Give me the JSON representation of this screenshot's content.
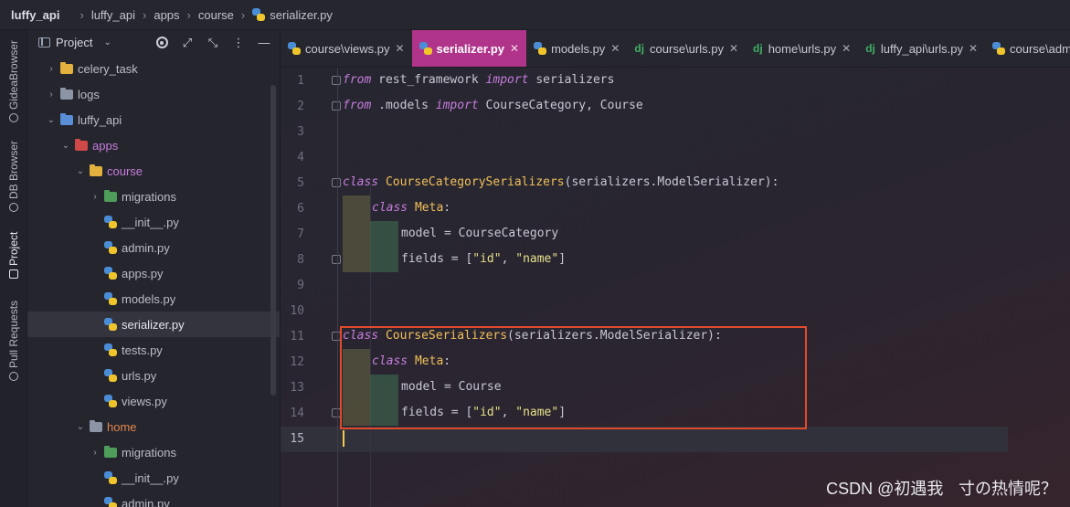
{
  "breadcrumb": {
    "items": [
      "luffy_api",
      "luffy_api",
      "apps",
      "course",
      "serializer.py"
    ]
  },
  "toolstrip": {
    "tabs": [
      "GideaBrowser",
      "DB Browser",
      "Project",
      "Pull Requests"
    ]
  },
  "project_panel": {
    "title": "Project",
    "tree": [
      {
        "label": "celery_task",
        "depth": 1,
        "kind": "folder"
      },
      {
        "label": "logs",
        "depth": 1,
        "kind": "folder"
      },
      {
        "label": "luffy_api",
        "depth": 1,
        "kind": "folder"
      },
      {
        "label": "apps",
        "depth": 2,
        "kind": "folder"
      },
      {
        "label": "course",
        "depth": 3,
        "kind": "folder"
      },
      {
        "label": "migrations",
        "depth": 4,
        "kind": "folder"
      },
      {
        "label": "__init__.py",
        "depth": 4,
        "kind": "file"
      },
      {
        "label": "admin.py",
        "depth": 4,
        "kind": "file"
      },
      {
        "label": "apps.py",
        "depth": 4,
        "kind": "file"
      },
      {
        "label": "models.py",
        "depth": 4,
        "kind": "file"
      },
      {
        "label": "serializer.py",
        "depth": 4,
        "kind": "file"
      },
      {
        "label": "tests.py",
        "depth": 4,
        "kind": "file"
      },
      {
        "label": "urls.py",
        "depth": 4,
        "kind": "file"
      },
      {
        "label": "views.py",
        "depth": 4,
        "kind": "file"
      },
      {
        "label": "home",
        "depth": 3,
        "kind": "folder"
      },
      {
        "label": "migrations",
        "depth": 4,
        "kind": "folder"
      },
      {
        "label": "__init__.py",
        "depth": 4,
        "kind": "file"
      },
      {
        "label": "admin.py",
        "depth": 4,
        "kind": "file"
      }
    ]
  },
  "tabs": [
    {
      "label": "course\\views.py",
      "icon": "python-icon"
    },
    {
      "label": "serializer.py",
      "icon": "python-icon"
    },
    {
      "label": "models.py",
      "icon": "python-icon"
    },
    {
      "label": "course\\urls.py",
      "icon": "django-icon",
      "prefix": "dj"
    },
    {
      "label": "home\\urls.py",
      "icon": "django-icon",
      "prefix": "dj"
    },
    {
      "label": "luffy_api\\urls.py",
      "icon": "django-icon",
      "prefix": "dj"
    },
    {
      "label": "course\\adm",
      "icon": "python-icon"
    }
  ],
  "editor": {
    "line_numbers": [
      "1",
      "2",
      "3",
      "4",
      "5",
      "6",
      "7",
      "8",
      "9",
      "10",
      "11",
      "12",
      "13",
      "14",
      "15"
    ],
    "code": {
      "l1_kw": "from",
      "l1_mod": " rest_framework ",
      "l1_kw2": "import",
      "l1_rest": " serializers",
      "l2_kw": "from",
      "l2_mod": " .models ",
      "l2_kw2": "import",
      "l2_rest": " CourseCategory, Course",
      "l5_kw": "class",
      "l5_name": " CourseCategorySerializers",
      "l5_rest": "(serializers.ModelSerializer):",
      "l6_kw": "class",
      "l6_name": " Meta",
      "l6_rest": ":",
      "l7_rest": "model = CourseCategory",
      "l8_pre": "fields = [",
      "l8_s1": "\"id\"",
      "l8_mid": ", ",
      "l8_s2": "\"name\"",
      "l8_post": "]",
      "l11_kw": "class",
      "l11_name": " CourseSerializers",
      "l11_rest": "(serializers.ModelSerializer):",
      "l12_kw": "class",
      "l12_name": " Meta",
      "l12_rest": ":",
      "l13_rest": "model = Course",
      "l14_pre": "fields = [",
      "l14_s1": "\"id\"",
      "l14_mid": ", ",
      "l14_s2": "\"name\"",
      "l14_post": "]"
    }
  },
  "watermark": "CSDN @初遇我ㅤ寸の热情呢？",
  "colors": {
    "accent": "#b0348a",
    "highlight_box": "#e04b2c",
    "keyword": "#c77ddc",
    "class_name": "#f0c05a"
  }
}
